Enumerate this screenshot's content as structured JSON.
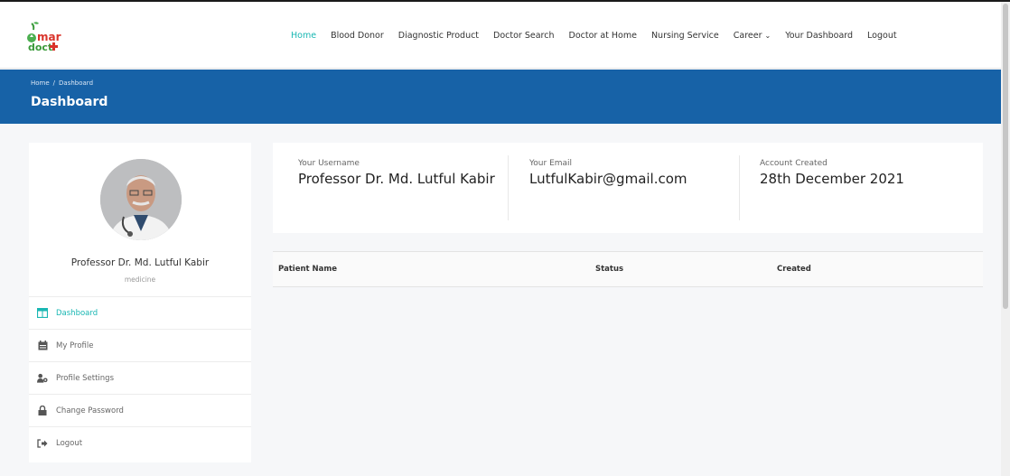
{
  "brand": {
    "logo_line1": "amar",
    "logo_line2": "doct",
    "name": "amar doctor"
  },
  "nav": {
    "items": [
      {
        "label": "Home",
        "active": true
      },
      {
        "label": "Blood Donor"
      },
      {
        "label": "Diagnostic Product"
      },
      {
        "label": "Doctor Search"
      },
      {
        "label": "Doctor at Home"
      },
      {
        "label": "Nursing Service"
      },
      {
        "label": "Career",
        "has_dropdown": true
      },
      {
        "label": "Your Dashboard"
      },
      {
        "label": "Logout"
      }
    ]
  },
  "breadcrumb": {
    "home": "Home",
    "separator": "/",
    "current": "Dashboard"
  },
  "page": {
    "title": "Dashboard"
  },
  "profile": {
    "name": "Professor Dr. Md. Lutful Kabir",
    "specialty": "medicine"
  },
  "sidebar": {
    "items": [
      {
        "label": "Dashboard",
        "icon": "dashboard-icon",
        "active": true
      },
      {
        "label": "My Profile",
        "icon": "calendar-icon"
      },
      {
        "label": "Profile Settings",
        "icon": "user-cog-icon"
      },
      {
        "label": "Change Password",
        "icon": "lock-icon"
      },
      {
        "label": "Logout",
        "icon": "sign-out-icon"
      }
    ]
  },
  "account": {
    "username_label": "Your Username",
    "username": "Professor Dr. Md. Lutful Kabir",
    "email_label": "Your Email",
    "email": "LutfulKabir@gmail.com",
    "created_label": "Account Created",
    "created": "28th December 2021"
  },
  "table": {
    "columns": [
      "Patient Name",
      "Status",
      "Created"
    ],
    "rows": []
  },
  "colors": {
    "accent": "#19b7b3",
    "banner": "#1762a7",
    "logo_green": "#4caf50",
    "logo_red": "#d9342b"
  }
}
